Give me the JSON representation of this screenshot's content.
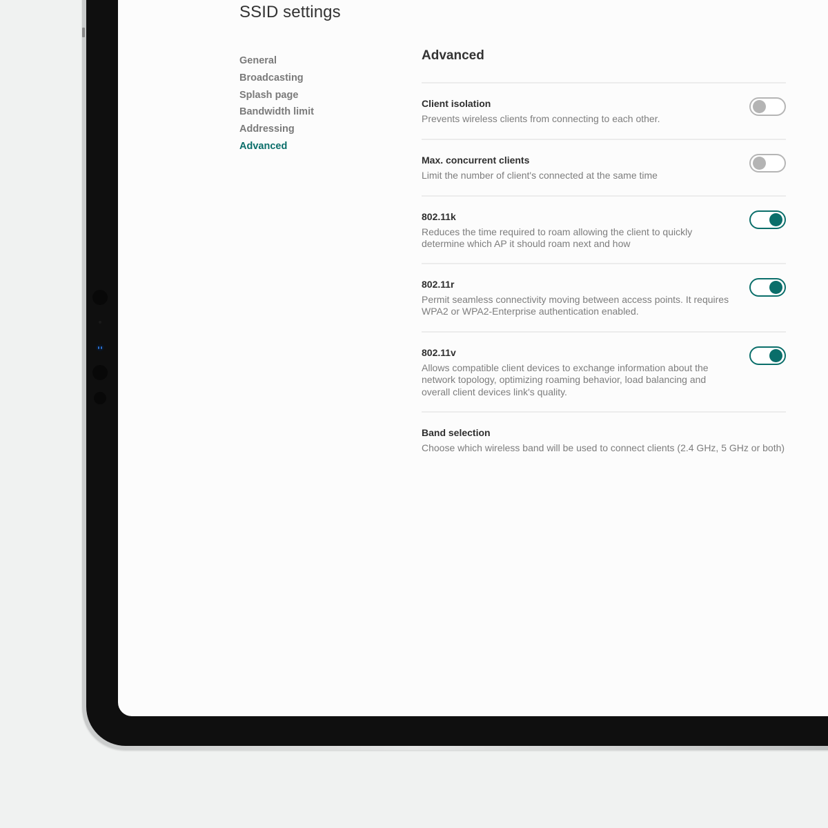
{
  "page": {
    "title": "SSID settings"
  },
  "side_nav": {
    "items": [
      {
        "label": "General",
        "active": false
      },
      {
        "label": "Broadcasting",
        "active": false
      },
      {
        "label": "Splash page",
        "active": false
      },
      {
        "label": "Bandwidth limit",
        "active": false
      },
      {
        "label": "Addressing",
        "active": false
      },
      {
        "label": "Advanced",
        "active": true
      }
    ]
  },
  "main": {
    "section_title": "Advanced",
    "settings": [
      {
        "label": "Client isolation",
        "description": "Prevents wireless clients from connecting to each other.",
        "toggle": "off"
      },
      {
        "label": "Max. concurrent clients",
        "description": "Limit the number of client's connected at the same time",
        "toggle": "off"
      },
      {
        "label": "802.11k",
        "description": "Reduces the time required to roam allowing the client to quickly determine which AP it should roam next and how",
        "toggle": "on"
      },
      {
        "label": "802.11r",
        "description": "Permit seamless connectivity moving between access points. It requires WPA2 or WPA2-Enterprise authentication enabled.",
        "toggle": "on"
      },
      {
        "label": "802.11v",
        "description": "Allows compatible client devices to exchange information about the network topology, optimizing roaming behavior, load balancing and overall client devices link's quality.",
        "toggle": "on"
      },
      {
        "label": "Band selection",
        "description": "Choose which wireless band will be used to connect clients (2.4 GHz, 5 GHz or both)",
        "toggle": null
      }
    ]
  },
  "colors": {
    "accent": "#0a6e6a",
    "toggle_off": "#b4b4b4",
    "text_primary": "#2e2e2e",
    "text_secondary": "#7d7d7d",
    "background": "#f0f2f1",
    "bezel": "#0f0f0f"
  }
}
